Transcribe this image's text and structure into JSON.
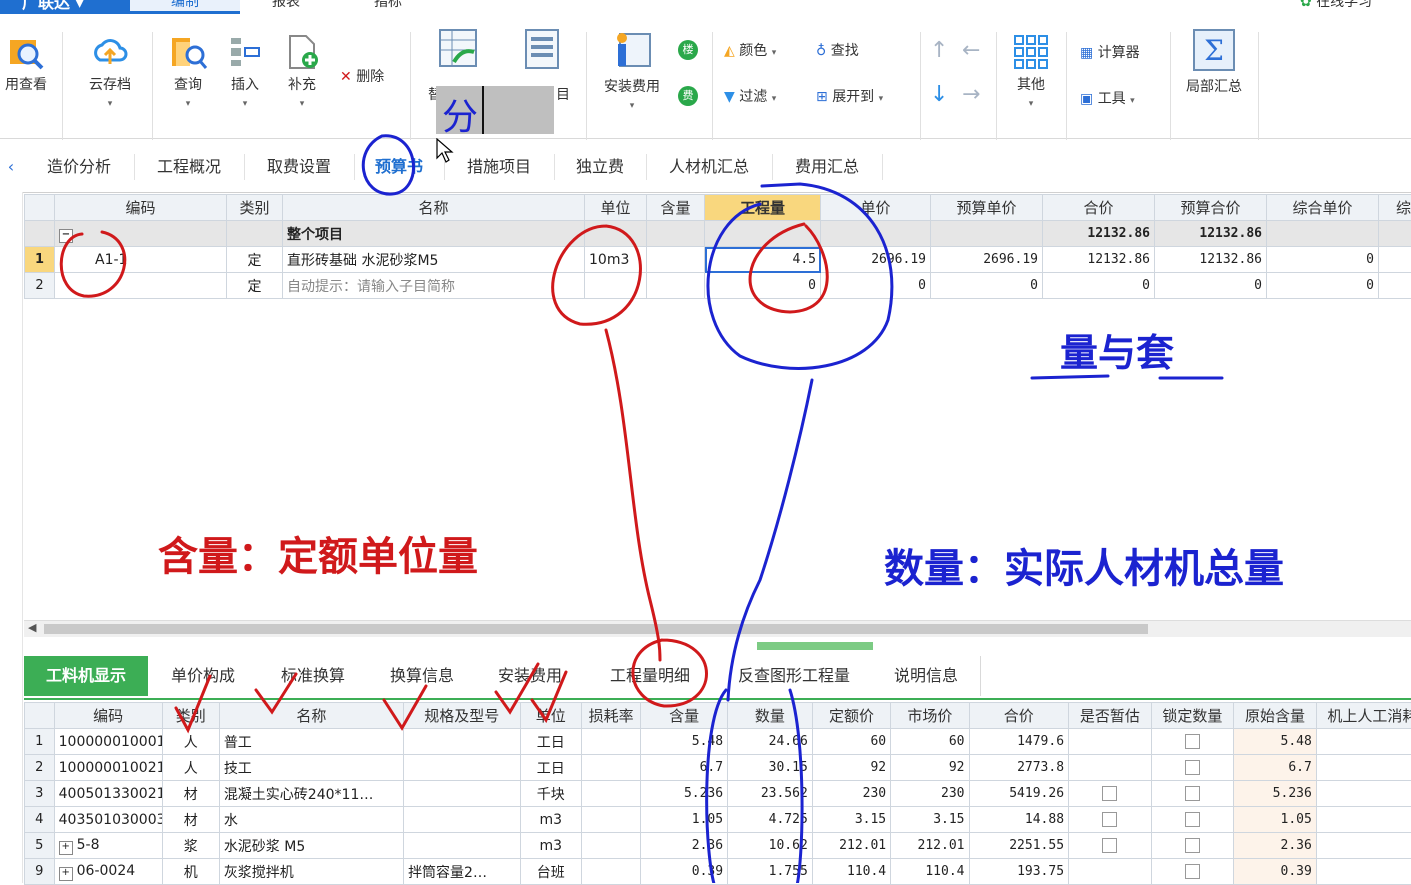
{
  "app": {
    "brand": "广联达",
    "menu_tabs": [
      "编制",
      "报表",
      "指标"
    ],
    "right_link": "在线学习"
  },
  "ribbon": {
    "buttons": [
      "用查看",
      "云存档",
      "查询",
      "插入",
      "补充",
      "删除",
      "分",
      "安装费用",
      "颜色",
      "过滤",
      "查找",
      "展开到",
      "其他",
      "计算器",
      "工具",
      "局部汇总"
    ],
    "partial_labels": [
      "替",
      "目"
    ],
    "small_icons": [
      "楼",
      "费"
    ]
  },
  "nav": {
    "back_icon": "chevron-left-icon",
    "tabs": [
      "造价分析",
      "工程概况",
      "取费设置",
      "预算书",
      "措施项目",
      "独立费",
      "人材机汇总",
      "费用汇总"
    ],
    "active": "预算书"
  },
  "upper_grid": {
    "columns": [
      "编码",
      "类别",
      "名称",
      "单位",
      "含量",
      "工程量",
      "单价",
      "预算单价",
      "合价",
      "预算合价",
      "综合单价",
      "综"
    ],
    "total_row": {
      "name": "整个项目",
      "hejia": "12132.86",
      "yusuan_hejia": "12132.86"
    },
    "rows": [
      {
        "idx": "1",
        "code": "A1-1",
        "type": "定",
        "name": "直形砖基础 水泥砂浆M5",
        "unit": "10m3",
        "qty": "4.5",
        "price": "2696.19",
        "budget_price": "2696.19",
        "total": "12132.86",
        "budget_total": "12132.86",
        "comp": "0"
      },
      {
        "idx": "2",
        "code": "",
        "type": "定",
        "name": "自动提示：请输入子目简称",
        "unit": "",
        "qty": "0",
        "price": "0",
        "budget_price": "0",
        "total": "0",
        "budget_total": "0",
        "comp": "0"
      }
    ]
  },
  "annotations": {
    "liang_yu_tao": "量与套",
    "hanliang": "含量：定额单位量",
    "shuliang": "数量：实际人材机总量"
  },
  "bottom_tabs": [
    "工料机显示",
    "单价构成",
    "标准换算",
    "换算信息",
    "安装费用",
    "工程量明细",
    "反查图形工程量",
    "说明信息"
  ],
  "lower_grid": {
    "columns": [
      "编码",
      "类别",
      "名称",
      "规格及型号",
      "单位",
      "损耗率",
      "含量",
      "数量",
      "定额价",
      "市场价",
      "合价",
      "是否暂估",
      "锁定数量",
      "原始含量",
      "机上人工消耗量"
    ],
    "rows": [
      {
        "idx": "1",
        "code": "100000010001",
        "type": "人",
        "name": "普工",
        "spec": "",
        "unit": "工日",
        "loss": "",
        "content": "5.48",
        "qty": "24.66",
        "quota": "60",
        "market": "60",
        "total": "1479.6",
        "est": false,
        "lock": true,
        "orig": "5.48"
      },
      {
        "idx": "2",
        "code": "100000010021",
        "type": "人",
        "name": "技工",
        "spec": "",
        "unit": "工日",
        "loss": "",
        "content": "6.7",
        "qty": "30.15",
        "quota": "92",
        "market": "92",
        "total": "2773.8",
        "est": false,
        "lock": true,
        "orig": "6.7"
      },
      {
        "idx": "3",
        "code": "400501330021",
        "type": "材",
        "name": "混凝土实心砖240*11…",
        "spec": "",
        "unit": "千块",
        "loss": "",
        "content": "5.236",
        "qty": "23.562",
        "quota": "230",
        "market": "230",
        "total": "5419.26",
        "est": true,
        "lock": true,
        "orig": "5.236"
      },
      {
        "idx": "4",
        "code": "403501030003",
        "type": "材",
        "name": "水",
        "spec": "",
        "unit": "m3",
        "loss": "",
        "content": "1.05",
        "qty": "4.725",
        "quota": "3.15",
        "market": "3.15",
        "total": "14.88",
        "est": true,
        "lock": true,
        "orig": "1.05"
      },
      {
        "idx": "5",
        "code": "5-8",
        "type": "浆",
        "name": "水泥砂浆 M5",
        "spec": "",
        "unit": "m3",
        "loss": "",
        "content": "2.36",
        "qty": "10.62",
        "quota": "212.01",
        "market": "212.01",
        "total": "2251.55",
        "est": true,
        "lock": true,
        "orig": "2.36"
      },
      {
        "idx": "9",
        "code": "06-0024",
        "type": "机",
        "name": "灰浆搅拌机",
        "spec": "拌筒容量2…",
        "unit": "台班",
        "loss": "",
        "content": "0.39",
        "qty": "1.755",
        "quota": "110.4",
        "market": "110.4",
        "total": "193.75",
        "est": false,
        "lock": true,
        "orig": "0.39"
      }
    ]
  },
  "colors": {
    "accent": "#1f6fd0",
    "green_tab": "#3cae55",
    "ink_red": "#d0191b",
    "ink_blue": "#1b23d0",
    "header_highlight": "#f9d77e"
  }
}
